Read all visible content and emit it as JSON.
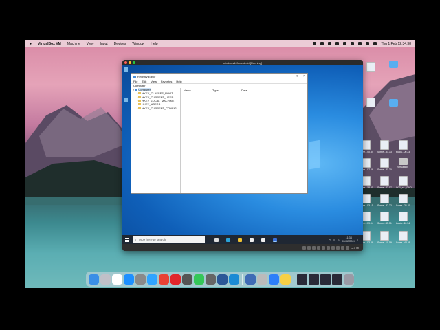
{
  "mac_menubar": {
    "app": "VirtualBox VM",
    "items": [
      "Machine",
      "View",
      "Input",
      "Devices",
      "Window",
      "Help"
    ],
    "clock": "Thu 1 Feb 12:34:38"
  },
  "vm_window": {
    "title": "windows10forandroid [Running]",
    "status_host_key": "Left ⌘"
  },
  "registry_editor": {
    "title": "Registry Editor",
    "menu": [
      "File",
      "Edit",
      "View",
      "Favorites",
      "Help"
    ],
    "address": "Computer",
    "tree_root": "Computer",
    "tree_keys": [
      "HKEY_CLASSES_ROOT",
      "HKEY_CURRENT_USER",
      "HKEY_LOCAL_MACHINE",
      "HKEY_USERS",
      "HKEY_CURRENT_CONFIG"
    ],
    "columns": [
      "Name",
      "Type",
      "Data"
    ]
  },
  "guest_taskbar": {
    "search_placeholder": "Type here to search",
    "time": "11:34",
    "date": "01/02/2024"
  },
  "desktop_icons": [
    {
      "label": "",
      "kind": "screenshot"
    },
    {
      "label": "",
      "kind": "folder"
    },
    {
      "label": "",
      "kind": "screenshot"
    },
    {
      "label": "",
      "kind": "folder"
    },
    {
      "label": "Scree...40.34",
      "kind": "screenshot"
    },
    {
      "label": "Scree...31.33",
      "kind": "screenshot"
    },
    {
      "label": "touch...00.23",
      "kind": "screenshot"
    },
    {
      "label": "Scree...07.29",
      "kind": "screenshot"
    },
    {
      "label": "Scree...31.30",
      "kind": "screenshot"
    },
    {
      "label": "VirtualBox",
      "kind": "drive"
    },
    {
      "label": "Scree...18.51",
      "kind": "screenshot"
    },
    {
      "label": "Scree...22.07",
      "kind": "screenshot"
    },
    {
      "label": "W11_x..._DVD",
      "kind": "screenshot"
    },
    {
      "label": "Scree...03.11",
      "kind": "screenshot"
    },
    {
      "label": "Scree...32.22",
      "kind": "screenshot"
    },
    {
      "label": "Scree...21.41",
      "kind": "screenshot"
    },
    {
      "label": "Scree...09.04",
      "kind": "screenshot"
    },
    {
      "label": "Scree...45.31",
      "kind": "screenshot"
    },
    {
      "label": "touch...10.54",
      "kind": "screenshot"
    },
    {
      "label": "Scree...02.29",
      "kind": "screenshot"
    },
    {
      "label": "Scree...10.19",
      "kind": "screenshot"
    },
    {
      "label": "Scree...40.58",
      "kind": "screenshot"
    }
  ],
  "dock": {
    "apps": [
      "finder-icon",
      "launchpad-icon",
      "calendar-icon",
      "app-store-icon",
      "system-settings-icon",
      "safari-icon",
      "chrome-icon",
      "opera-icon",
      "screenshot-icon",
      "messages-icon",
      "calculator-icon",
      "word-icon",
      "edge-icon",
      "virtualbox-icon",
      "preview-icon",
      "keynote-icon",
      "notes-icon"
    ],
    "minimized": [
      "window-thumb-1",
      "window-thumb-2",
      "window-thumb-3",
      "window-thumb-4"
    ],
    "trash": "trash-icon"
  },
  "colors": {
    "win_accent": "#0f5fb8",
    "folder": "#e8c25a",
    "taskbar": "#1f2733"
  }
}
